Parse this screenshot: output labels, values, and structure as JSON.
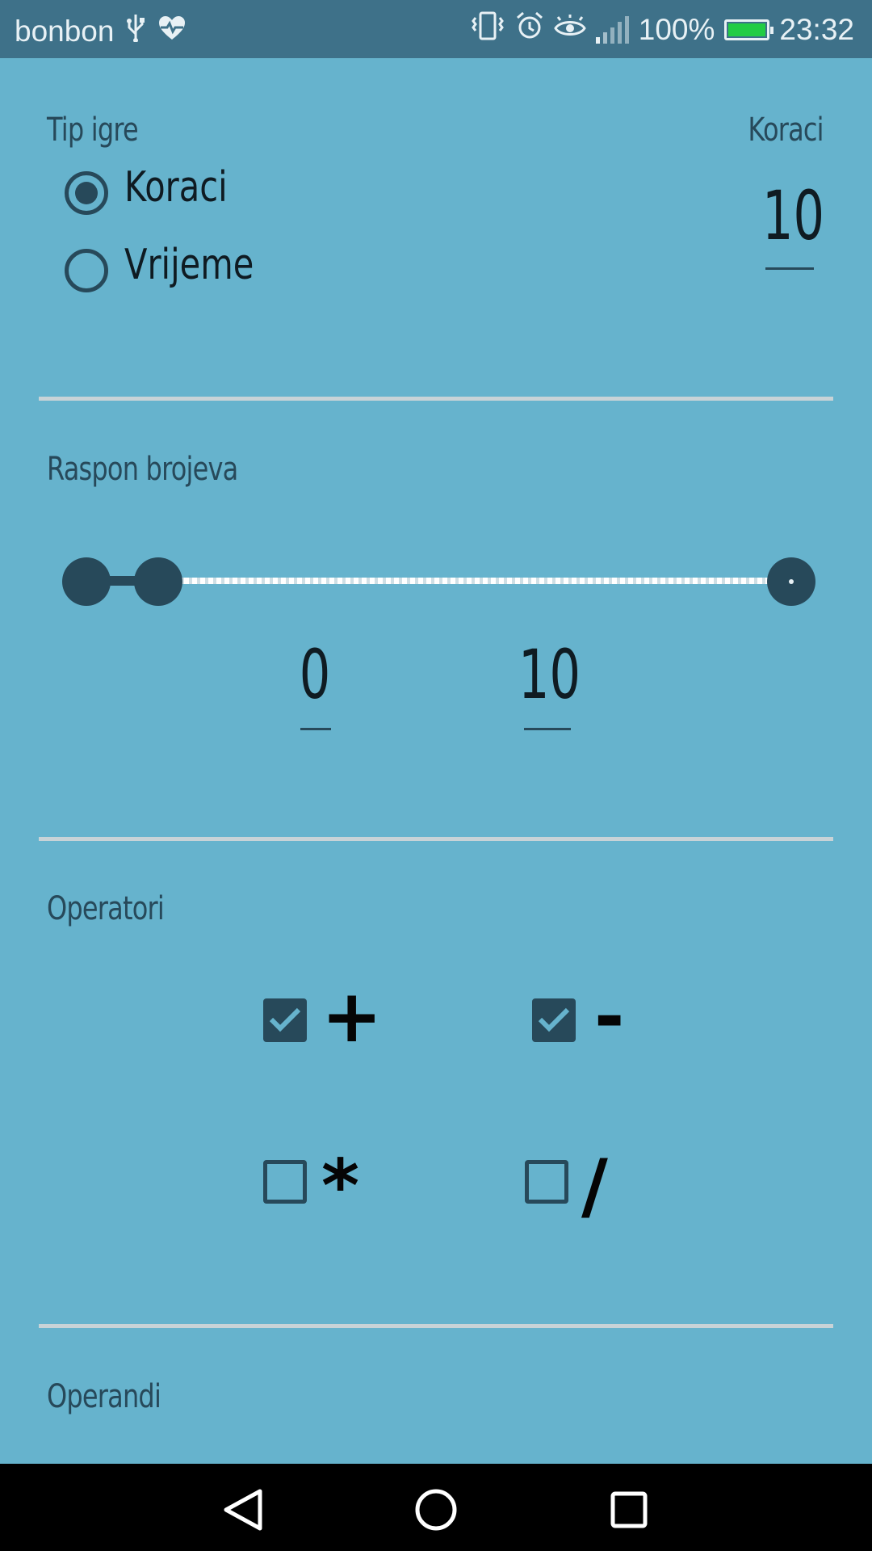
{
  "status_bar": {
    "carrier": "bonbon",
    "battery": "100%",
    "time": "23:32",
    "icons": [
      "usb-icon",
      "heart-pulse-icon",
      "vibrate-icon",
      "alarm-icon",
      "eye-icon",
      "signal-icon",
      "battery-charging-icon"
    ]
  },
  "game_type": {
    "label": "Tip igre",
    "options": [
      {
        "label": "Koraci",
        "checked": true
      },
      {
        "label": "Vrijeme",
        "checked": false
      }
    ],
    "value_label": "Koraci",
    "value": "10"
  },
  "range": {
    "label": "Raspon brojeva",
    "min_value": "0",
    "max_value": "10",
    "slider_low_fraction": 0.0,
    "slider_high_fraction": 0.1
  },
  "operators": {
    "label": "Operatori",
    "items": [
      {
        "symbol": "+",
        "checked": true
      },
      {
        "symbol": "-",
        "checked": true
      },
      {
        "symbol": "*",
        "checked": false
      },
      {
        "symbol": "/",
        "checked": false
      }
    ]
  },
  "operands": {
    "label": "Operandi"
  },
  "nav": {
    "icons": [
      "back-icon",
      "home-icon",
      "recents-icon"
    ]
  },
  "colors": {
    "background": "#66b3cd",
    "status_bar": "#3e7189",
    "accent": "#27495a",
    "divider": "#c8d3d7"
  }
}
